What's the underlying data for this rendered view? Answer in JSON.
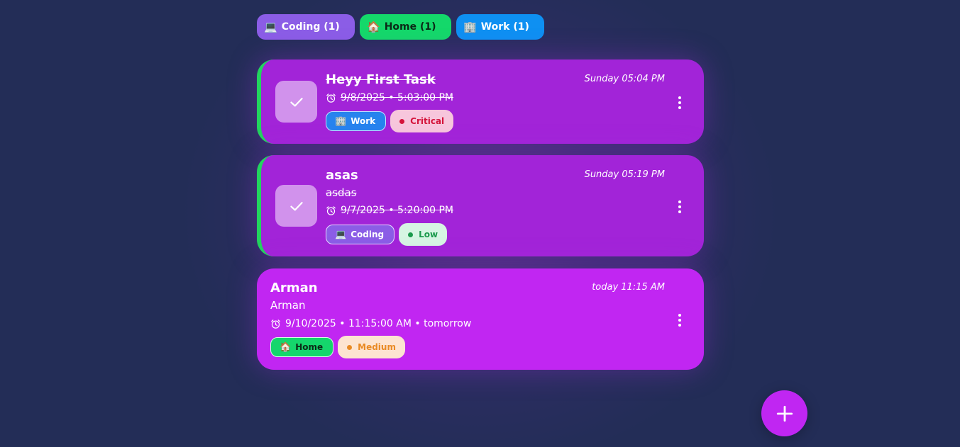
{
  "categories": [
    {
      "icon": "💻",
      "label": "Coding",
      "count": "(1)"
    },
    {
      "icon": "🏠",
      "label": "Home",
      "count": "(1)"
    },
    {
      "icon": "🏢",
      "label": "Work",
      "count": "(1)"
    }
  ],
  "tasks": [
    {
      "title": "Heyy First Task",
      "due": "9/8/2025 • 5:03:00 PM",
      "timestamp": "Sunday 05:04 PM",
      "category_icon": "🏢",
      "category": "Work",
      "priority": "Critical",
      "completed": true
    },
    {
      "title": "asas",
      "description": "asdas",
      "due": "9/7/2025 • 5:20:00 PM",
      "timestamp": "Sunday 05:19 PM",
      "category_icon": "💻",
      "category": "Coding",
      "priority": "Low",
      "completed": true
    },
    {
      "title": "Arman",
      "description": "Arman",
      "due": "9/10/2025 • 11:15:00 AM • tomorrow",
      "timestamp": "today 11:15 AM",
      "category_icon": "🏠",
      "category": "Home",
      "priority": "Medium",
      "completed": false
    }
  ],
  "colors": {
    "background": "#232d57",
    "done_card": "#a224d8",
    "open_card": "#c126f2",
    "done_border": "#22d45e",
    "fab": "#c026f2"
  }
}
